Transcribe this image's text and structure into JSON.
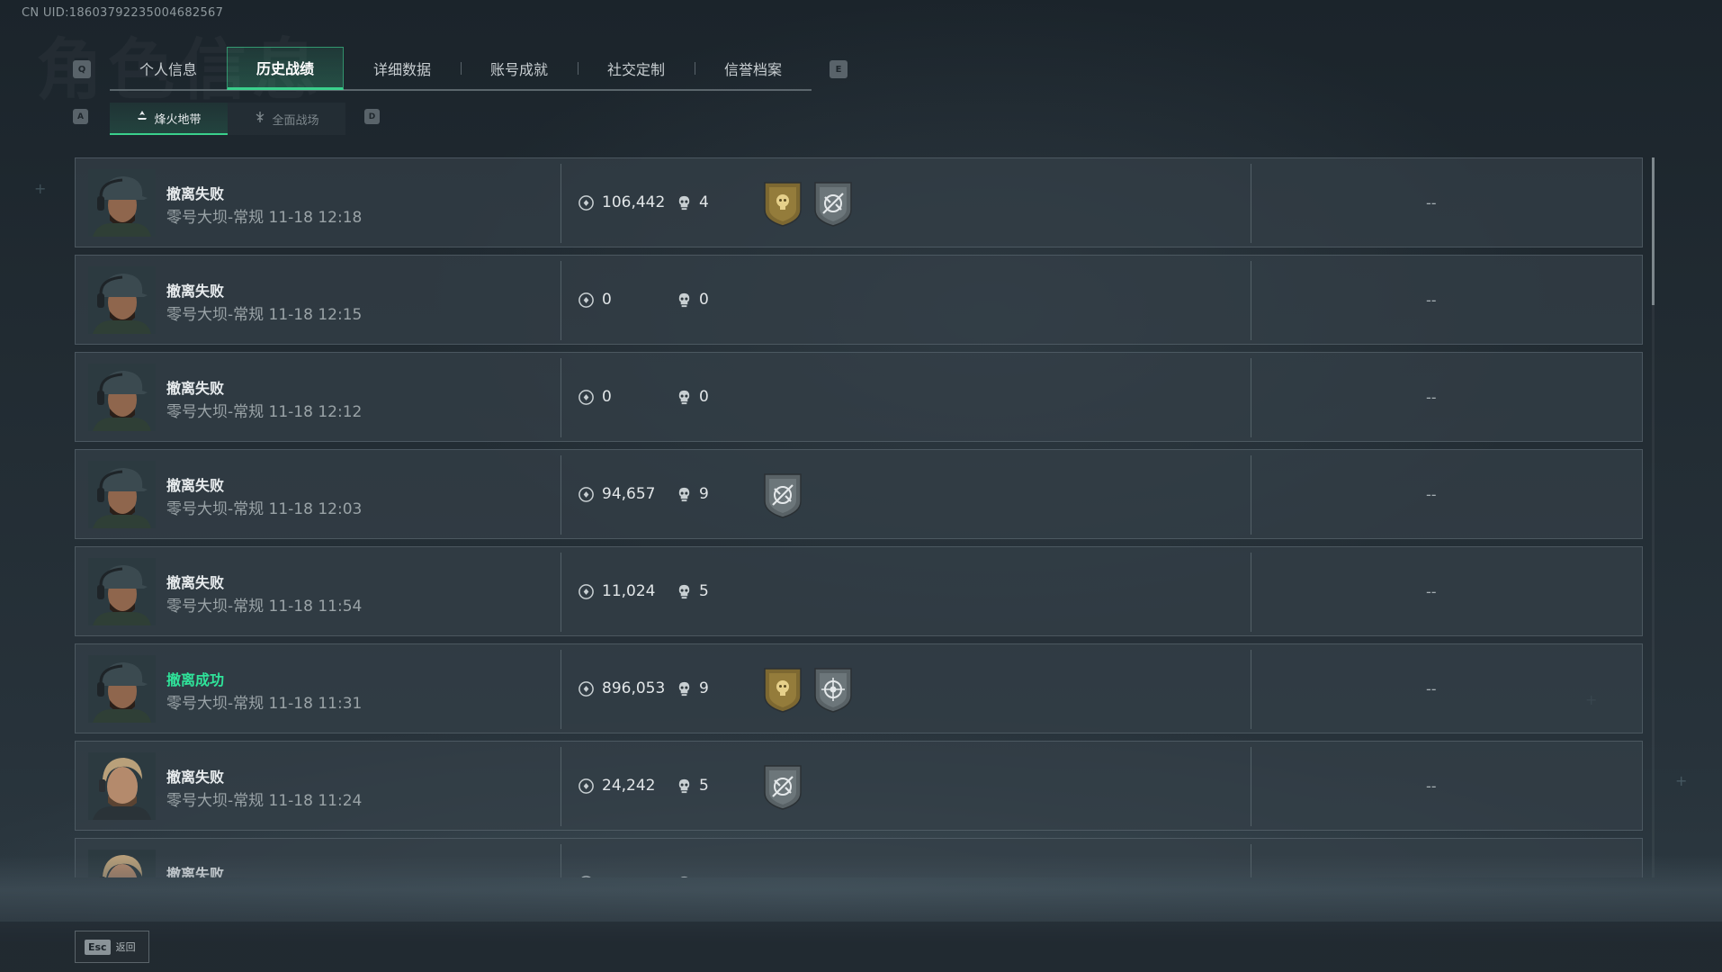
{
  "uid": "CN UID:18603792235004682567",
  "watermark": "角色信息",
  "tabs": {
    "prev_key": "Q",
    "next_key": "E",
    "items": [
      {
        "label": "个人信息"
      },
      {
        "label": "历史战绩",
        "active": true
      },
      {
        "label": "详细数据"
      },
      {
        "label": "账号成就"
      },
      {
        "label": "社交定制"
      },
      {
        "label": "信誉档案"
      }
    ]
  },
  "subtabs": {
    "prev_key": "A",
    "next_key": "D",
    "items": [
      {
        "label": "烽火地带",
        "active": true
      },
      {
        "label": "全面战场"
      }
    ]
  },
  "records": [
    {
      "status": "撤离失败",
      "success": false,
      "map_time": "零号大坝-常规 11-18 12:18",
      "value": "106,442",
      "kills": "4",
      "badges": [
        "gold-skull-badge",
        "gray-crosshair-badge"
      ],
      "result": "--",
      "avatar": "operator-cap-avatar"
    },
    {
      "status": "撤离失败",
      "success": false,
      "map_time": "零号大坝-常规 11-18 12:15",
      "value": "0",
      "kills": "0",
      "badges": [],
      "result": "--",
      "avatar": "operator-cap-avatar"
    },
    {
      "status": "撤离失败",
      "success": false,
      "map_time": "零号大坝-常规 11-18 12:12",
      "value": "0",
      "kills": "0",
      "badges": [],
      "result": "--",
      "avatar": "operator-cap-avatar"
    },
    {
      "status": "撤离失败",
      "success": false,
      "map_time": "零号大坝-常规 11-18 12:03",
      "value": "94,657",
      "kills": "9",
      "badges": [
        "gray-crosshair-badge"
      ],
      "result": "--",
      "avatar": "operator-cap-avatar"
    },
    {
      "status": "撤离失败",
      "success": false,
      "map_time": "零号大坝-常规 11-18 11:54",
      "value": "11,024",
      "kills": "5",
      "badges": [],
      "result": "--",
      "avatar": "operator-cap-avatar"
    },
    {
      "status": "撤离成功",
      "success": true,
      "map_time": "零号大坝-常规 11-18 11:31",
      "value": "896,053",
      "kills": "9",
      "badges": [
        "gold-skull-badge",
        "gray-target-badge"
      ],
      "result": "--",
      "avatar": "operator-cap-avatar"
    },
    {
      "status": "撤离失败",
      "success": false,
      "map_time": "零号大坝-常规 11-18 11:24",
      "value": "24,242",
      "kills": "5",
      "badges": [
        "gray-crosshair-badge"
      ],
      "result": "--",
      "avatar": "operator-blond-avatar"
    },
    {
      "status": "撤离失败",
      "success": false,
      "map_time": "",
      "value": "",
      "kills": "",
      "badges": [],
      "result": "",
      "avatar": "operator-blond-avatar"
    }
  ],
  "footer": {
    "esc_key": "Esc",
    "esc_label": "返回"
  },
  "colors": {
    "accent": "#3ad08c",
    "success_text": "#2fe39a",
    "badge_gold": "#8a7234",
    "badge_gray": "#5e676b"
  }
}
